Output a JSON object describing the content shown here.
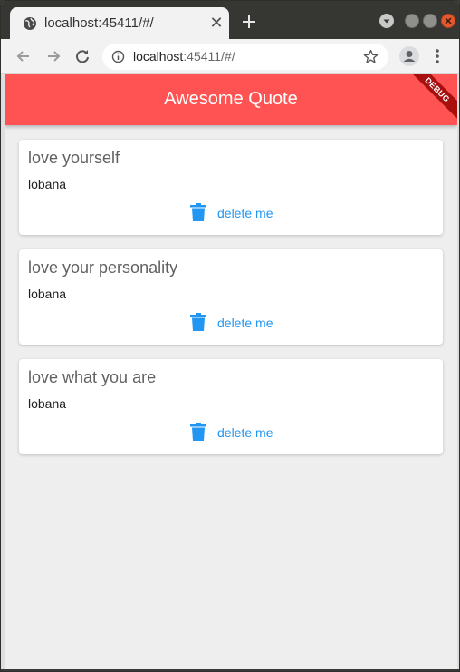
{
  "browser": {
    "tab_title": "localhost:45411/#/",
    "url_host": "localhost",
    "url_rest": ":45411/#/",
    "tab_close": "✕",
    "icons": {
      "favicon": "globe-icon",
      "new_tab": "plus-icon",
      "back": "arrow-left-icon",
      "forward": "arrow-right-icon",
      "reload": "reload-icon",
      "info": "info-icon",
      "bookmark": "star-icon",
      "profile": "profile-icon",
      "menu": "kebab-menu-icon"
    }
  },
  "app": {
    "title": "Awesome Quote",
    "debug_banner": "DEBUG",
    "accent_color": "#ff5252",
    "action_color": "#2196f3",
    "quotes": [
      {
        "text": "love yourself",
        "author": "lobana",
        "delete_label": "delete me"
      },
      {
        "text": "love your personality",
        "author": "lobana",
        "delete_label": "delete me"
      },
      {
        "text": "love what you are",
        "author": "lobana",
        "delete_label": "delete me"
      }
    ]
  }
}
